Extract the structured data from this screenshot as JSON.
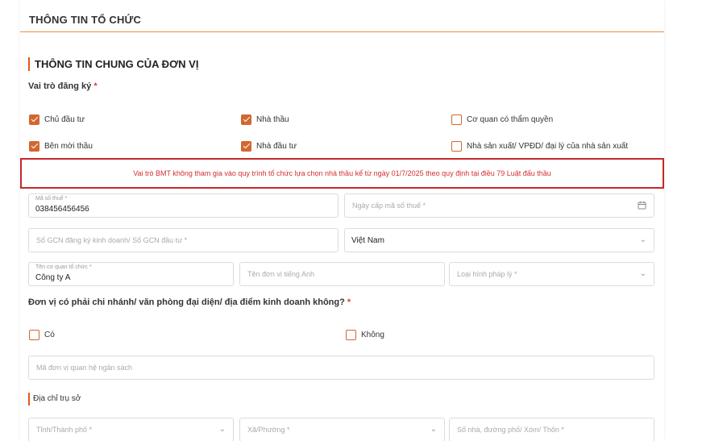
{
  "header": {
    "title": "THÔNG TIN TỔ CHỨC"
  },
  "section": {
    "title": "THÔNG TIN CHUNG CỦA ĐƠN VỊ"
  },
  "role": {
    "label": "Vai trò đăng ký",
    "required_mark": "*",
    "options": [
      {
        "label": "Chủ đầu tư",
        "checked": true
      },
      {
        "label": "Nhà thầu",
        "checked": true
      },
      {
        "label": "Cơ quan có thẩm quyền",
        "checked": false
      },
      {
        "label": "Bên mời thầu",
        "checked": true
      },
      {
        "label": "Nhà đầu tư",
        "checked": true
      },
      {
        "label": "Nhà sản xuất/ VPĐD/ đại lý của nhà sản xuất",
        "checked": false
      }
    ]
  },
  "warning": {
    "text": "Vai trò BMT không tham gia vào quy trình tổ chức lựa chọn nhà thầu kể từ ngày 01/7/2025 theo quy định tại điều 79 Luật đấu thầu"
  },
  "fields": {
    "tax_code": {
      "label": "Mã số thuế *",
      "value": "038456456456"
    },
    "tax_date": {
      "placeholder": "Ngày cấp mã số thuế *"
    },
    "gcn": {
      "placeholder": "Số GCN đăng ký kinh doanh/ Số GCN đầu tư *"
    },
    "country": {
      "value": "Việt Nam"
    },
    "org_name": {
      "label": "Tên cơ quan tổ chức *",
      "value": "Công ty A"
    },
    "english_name": {
      "placeholder": "Tên đơn vị tiếng Anh"
    },
    "legal_type": {
      "placeholder": "Loại hình pháp lý *"
    },
    "budget_code": {
      "placeholder": "Mã đơn vị quan hệ ngân sách"
    },
    "province": {
      "placeholder": "Tỉnh/Thành phố *"
    },
    "ward": {
      "placeholder": "Xã/Phường *"
    },
    "street": {
      "placeholder": "Số nhà, đường phố/ Xóm/ Thôn *"
    }
  },
  "branch": {
    "question": "Đơn vị có phải chi nhánh/ văn phòng đại diện/ địa điểm kinh doanh không?",
    "required_mark": "*",
    "yes_label": "Có",
    "no_label": "Không"
  },
  "address": {
    "label": "Địa chỉ trụ sở"
  },
  "icons": {
    "calendar": "calendar-icon",
    "chevron": "chevron-down-icon"
  },
  "colors": {
    "accent": "#d2672f",
    "warning": "#c62828",
    "border": "#dcdcdc"
  }
}
